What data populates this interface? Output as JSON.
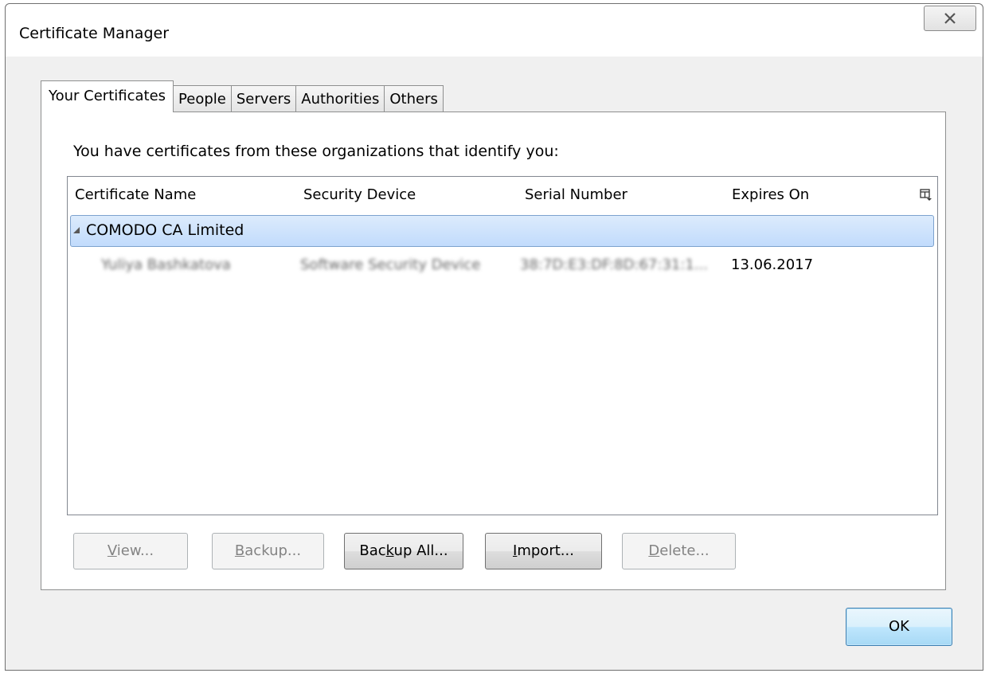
{
  "window": {
    "title": "Certificate Manager"
  },
  "tabs": [
    {
      "label": "Your Certificates",
      "active": true
    },
    {
      "label": "People"
    },
    {
      "label": "Servers"
    },
    {
      "label": "Authorities"
    },
    {
      "label": "Others"
    }
  ],
  "panel": {
    "intro": "You have certificates from these organizations that identify you:"
  },
  "table": {
    "columns": [
      "Certificate Name",
      "Security Device",
      "Serial Number",
      "Expires On"
    ],
    "groups": [
      {
        "name": "COMODO CA Limited",
        "rows": [
          {
            "name": "Yuliya Bashkatova",
            "device": "Software Security Device",
            "serial": "38:7D:E3:DF:8D:67:31:1...",
            "expires": "13.06.2017"
          }
        ]
      }
    ]
  },
  "buttons": {
    "view": {
      "pre": "",
      "acc": "V",
      "post": "iew..."
    },
    "backup": {
      "pre": "",
      "acc": "B",
      "post": "ackup..."
    },
    "backup_all": {
      "pre": "Bac",
      "acc": "k",
      "post": "up All..."
    },
    "import": {
      "pre": "",
      "acc": "I",
      "post": "mport..."
    },
    "delete": {
      "pre": "",
      "acc": "D",
      "post": "elete..."
    },
    "ok": "OK"
  },
  "icons": {
    "close": "close-icon",
    "column_picker": "column-picker-icon",
    "expand": "expanded-triangle-icon"
  },
  "colors": {
    "selection_top": "#dcebfc",
    "selection_bottom": "#c1dbfc",
    "selection_border": "#7da2ce"
  }
}
